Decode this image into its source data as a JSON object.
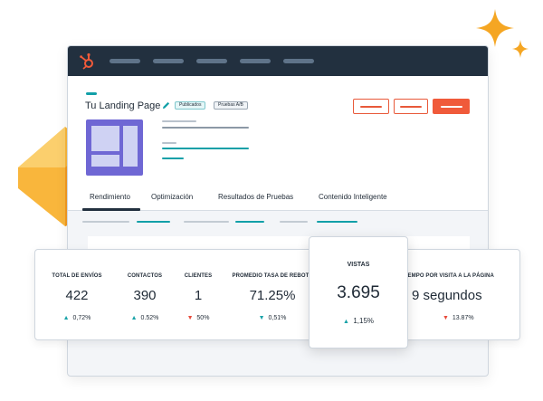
{
  "page": {
    "title": "Tu Landing Page",
    "tags": [
      "Publicados",
      "Pruebas A/B"
    ]
  },
  "icons": {
    "logo": "hubspot-sprocket-icon",
    "edit": "pencil-icon",
    "up": "triangle-up-icon",
    "down": "triangle-down-icon",
    "sparkle": "sparkle-icon"
  },
  "tabs": [
    "Rendimiento",
    "Optimización",
    "Resultados de Pruebas",
    "Contenido Inteligente"
  ],
  "stats": [
    {
      "label": "TOTAL DE ENVÍOS",
      "value": "422",
      "change": "0,72%",
      "direction": "up"
    },
    {
      "label": "CONTACTOS",
      "value": "390",
      "change": "0.52%",
      "direction": "up"
    },
    {
      "label": "CLIENTES",
      "value": "1",
      "change": "50%",
      "direction": "down"
    },
    {
      "label": "PROMEDIO TASA DE REBOTE",
      "value": "71.25%",
      "change": "0,51%",
      "direction": "down"
    },
    {
      "label": "TIEMPO POR VISITA A LA PÁGINA",
      "value": "9 segundos",
      "change": "13.87%",
      "direction": "down"
    }
  ],
  "featured": {
    "label": "VISTAS",
    "value": "3.695",
    "change": "1,15%",
    "direction": "up"
  },
  "glyphs": {
    "up": "▲",
    "down": "▼"
  },
  "colors": {
    "accent_orange": "#f05a3a",
    "teal": "#12a0a8",
    "navy": "#22303f",
    "purple": "#6f67d4",
    "gold": "#f5a623",
    "down_red": "#e84b3c"
  }
}
